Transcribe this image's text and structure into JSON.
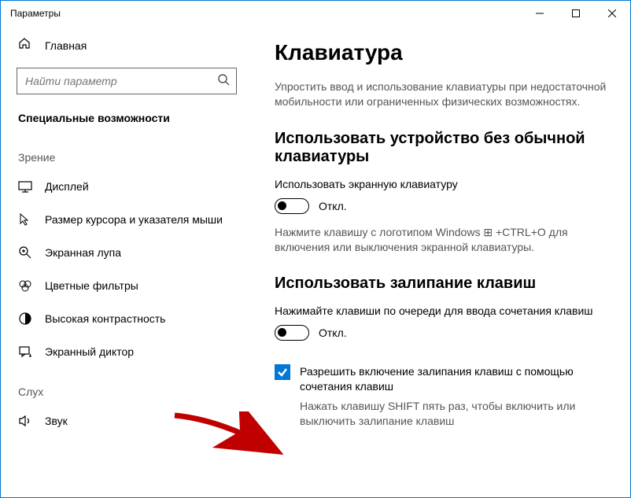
{
  "window": {
    "title": "Параметры"
  },
  "sidebar": {
    "home": "Главная",
    "search_placeholder": "Найти параметр",
    "category": "Специальные возможности",
    "group1": "Зрение",
    "items": [
      {
        "label": "Дисплей"
      },
      {
        "label": "Размер курсора и указателя мыши"
      },
      {
        "label": "Экранная лупа"
      },
      {
        "label": "Цветные фильтры"
      },
      {
        "label": "Высокая контрастность"
      },
      {
        "label": "Экранный диктор"
      }
    ],
    "group2": "Слух",
    "items2": [
      {
        "label": "Звук"
      }
    ]
  },
  "main": {
    "title": "Клавиатура",
    "intro": "Упростить ввод и использование клавиатуры при недостаточной мобильности или ограниченных физических возможностях.",
    "section1": {
      "heading": "Использовать устройство без обычной клавиатуры",
      "label": "Использовать экранную клавиатуру",
      "toggle_state": "Откл.",
      "hint_pre": "Нажмите клавишу с логотипом Windows ",
      "hint_post": " +CTRL+O для включения или выключения экранной клавиатуры."
    },
    "section2": {
      "heading": "Использовать залипание клавиш",
      "label": "Нажимайте клавиши по очереди для ввода сочетания клавиш",
      "toggle_state": "Откл.",
      "checkbox_label": "Разрешить включение залипания клавиш с помощью сочетания клавиш",
      "checkbox_hint": "Нажать клавишу SHIFT пять раз, чтобы включить или выключить залипание клавиш"
    }
  }
}
